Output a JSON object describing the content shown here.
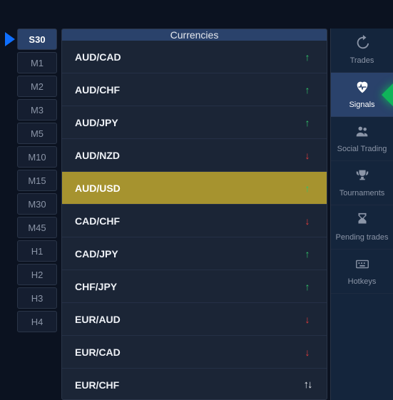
{
  "timeframes": {
    "items": [
      {
        "label": "S30",
        "active": true
      },
      {
        "label": "M1",
        "active": false
      },
      {
        "label": "M2",
        "active": false
      },
      {
        "label": "M3",
        "active": false
      },
      {
        "label": "M5",
        "active": false
      },
      {
        "label": "M10",
        "active": false
      },
      {
        "label": "M15",
        "active": false
      },
      {
        "label": "M30",
        "active": false
      },
      {
        "label": "M45",
        "active": false
      },
      {
        "label": "H1",
        "active": false
      },
      {
        "label": "H2",
        "active": false
      },
      {
        "label": "H3",
        "active": false
      },
      {
        "label": "H4",
        "active": false
      }
    ]
  },
  "currencies": {
    "header": "Currencies",
    "rows": [
      {
        "pair": "AUD/CAD",
        "dir": "up",
        "highlight": false
      },
      {
        "pair": "AUD/CHF",
        "dir": "up",
        "highlight": false
      },
      {
        "pair": "AUD/JPY",
        "dir": "up",
        "highlight": false
      },
      {
        "pair": "AUD/NZD",
        "dir": "down",
        "highlight": false
      },
      {
        "pair": "AUD/USD",
        "dir": "up",
        "highlight": true
      },
      {
        "pair": "CAD/CHF",
        "dir": "down",
        "highlight": false
      },
      {
        "pair": "CAD/JPY",
        "dir": "up",
        "highlight": false
      },
      {
        "pair": "CHF/JPY",
        "dir": "up",
        "highlight": false
      },
      {
        "pair": "EUR/AUD",
        "dir": "down",
        "highlight": false
      },
      {
        "pair": "EUR/CAD",
        "dir": "down",
        "highlight": false
      },
      {
        "pair": "EUR/CHF",
        "dir": "neutral",
        "highlight": false
      }
    ]
  },
  "rightnav": {
    "items": [
      {
        "label": "Trades",
        "icon": "history",
        "active": false
      },
      {
        "label": "Signals",
        "icon": "heartbeat",
        "active": true
      },
      {
        "label": "Social Trading",
        "icon": "users",
        "active": false
      },
      {
        "label": "Tournaments",
        "icon": "trophy",
        "active": false
      },
      {
        "label": "Pending trades",
        "icon": "hourglass",
        "active": false
      },
      {
        "label": "Hotkeys",
        "icon": "keyboard",
        "active": false
      }
    ]
  }
}
